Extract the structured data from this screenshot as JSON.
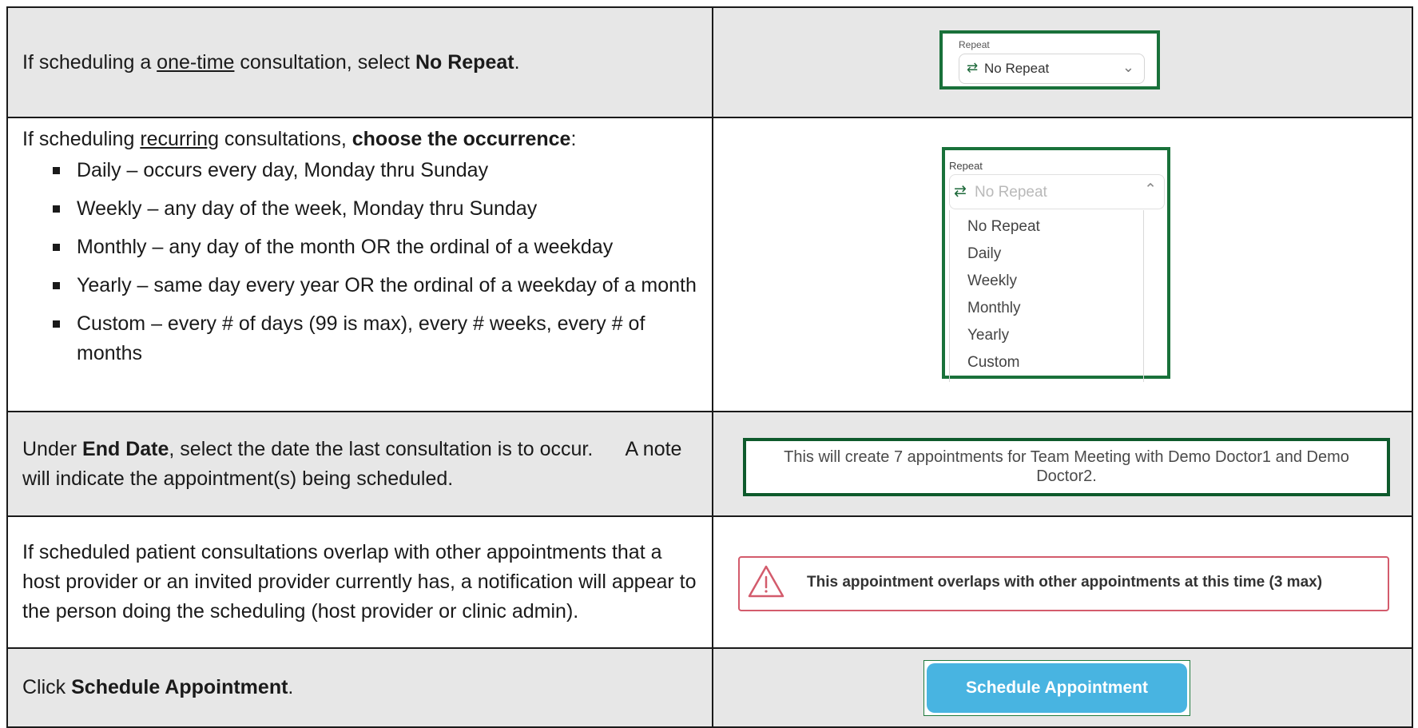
{
  "rows": [
    {
      "instruction": {
        "pre": "If scheduling a ",
        "underline": "one-time",
        "mid": " consultation, select ",
        "bold": "No Repeat",
        "post": "."
      },
      "repeat_select": {
        "label": "Repeat",
        "value": "No Repeat",
        "icon": "repeat-icon"
      }
    },
    {
      "instruction": {
        "pre": "If scheduling ",
        "underline": "recurring",
        "mid": " consultations, ",
        "bold": "choose the occurrence",
        "post": ":",
        "bullets": [
          "Daily – occurs every day, Monday thru Sunday",
          "Weekly – any day of the week, Monday thru Sunday",
          "Monthly – any day of the month OR the ordinal of a weekday",
          "Yearly – same day every year OR the ordinal of a weekday of a month",
          "Custom – every # of days (99 is max), every # weeks, every # of months"
        ]
      },
      "repeat_dropdown": {
        "label": "Repeat",
        "value": "No Repeat",
        "options": [
          "No Repeat",
          "Daily",
          "Weekly",
          "Monthly",
          "Yearly",
          "Custom"
        ]
      }
    },
    {
      "instruction": {
        "pre": "Under ",
        "bold": "End Date",
        "post": ", select the date the last consultation is to occur.      A note will indicate the appointment(s) being scheduled."
      },
      "note": "This will create 7 appointments for Team Meeting with Demo Doctor1 and Demo Doctor2."
    },
    {
      "instruction": {
        "text": "If scheduled  patient consultations overlap with other appointments that a host provider or an invited provider currently has, a notification will appear to the person doing the scheduling (host provider or clinic admin)."
      },
      "warning": "This appointment overlaps with other appointments at this time (3 max)"
    },
    {
      "instruction": {
        "pre": "Click ",
        "bold": "Schedule Appointment",
        "post": "."
      },
      "button_label": "Schedule Appointment"
    }
  ],
  "colors": {
    "highlight_border": "#19713a",
    "warning_border": "#d35b6c",
    "button_bg": "#48b4e1",
    "shaded_row": "#e7e7e7"
  }
}
